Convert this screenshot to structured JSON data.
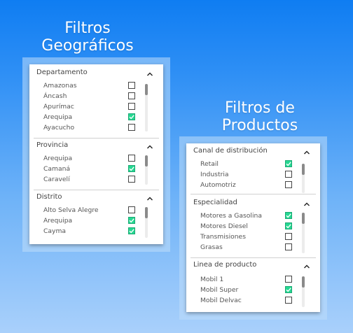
{
  "geo": {
    "title_line1": "Filtros",
    "title_line2": "Geográficos",
    "sections": [
      {
        "header": "Departamento",
        "items": [
          {
            "label": "Amazonas",
            "checked": false
          },
          {
            "label": "Áncash",
            "checked": false
          },
          {
            "label": "Apurímac",
            "checked": false
          },
          {
            "label": "Arequipa",
            "checked": true
          },
          {
            "label": "Ayacucho",
            "checked": false
          }
        ]
      },
      {
        "header": "Provincia",
        "items": [
          {
            "label": "Arequipa",
            "checked": false
          },
          {
            "label": "Camaná",
            "checked": true
          },
          {
            "label": "Caravelí",
            "checked": false
          }
        ]
      },
      {
        "header": "Distrito",
        "items": [
          {
            "label": "Alto Selva Alegre",
            "checked": false
          },
          {
            "label": "Arequipa",
            "checked": true
          },
          {
            "label": "Cayma",
            "checked": true
          }
        ]
      }
    ]
  },
  "prod": {
    "title_line1": "Filtros de",
    "title_line2": "Productos",
    "sections": [
      {
        "header": "Canal de distribución",
        "items": [
          {
            "label": "Retail",
            "checked": true
          },
          {
            "label": "Industria",
            "checked": false
          },
          {
            "label": "Automotriz",
            "checked": false
          }
        ]
      },
      {
        "header": "Especialidad",
        "items": [
          {
            "label": "Motores a Gasolina",
            "checked": true
          },
          {
            "label": "Motores Diesel",
            "checked": true
          },
          {
            "label": "Transmisiones",
            "checked": false
          },
          {
            "label": "Grasas",
            "checked": false
          }
        ]
      },
      {
        "header": "Linea de producto",
        "items": [
          {
            "label": "Mobil 1",
            "checked": false
          },
          {
            "label": "Mobil Super",
            "checked": true
          },
          {
            "label": "Mobil Delvac",
            "checked": false
          }
        ]
      }
    ]
  },
  "colors": {
    "checked_fill": "#27d892",
    "bg_top": "#0f7df2",
    "bg_bottom": "#a9d0fb"
  },
  "icons": {
    "collapse": "chevron-up-icon",
    "check": "check-icon"
  }
}
